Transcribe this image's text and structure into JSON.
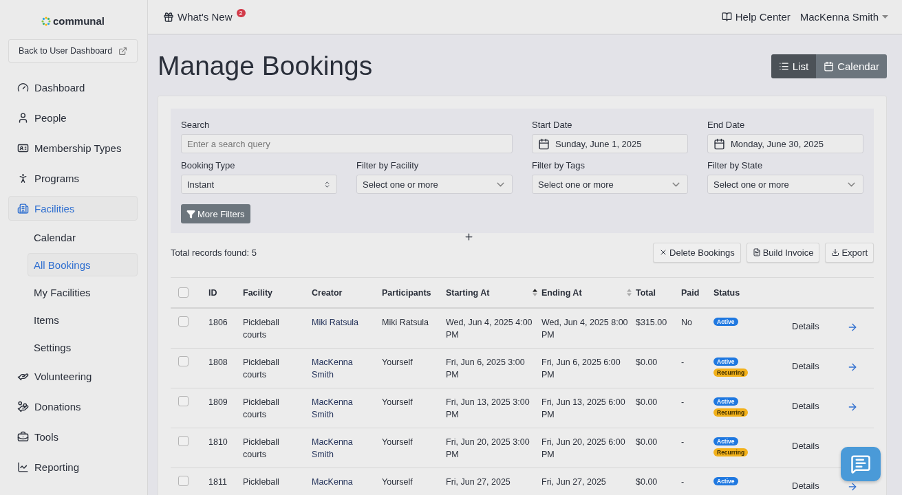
{
  "sidebar": {
    "logo": "communal",
    "back_button": "Back to User Dashboard",
    "items": [
      {
        "label": "Dashboard",
        "selected": false
      },
      {
        "label": "People",
        "selected": false
      },
      {
        "label": "Membership Types",
        "selected": false
      },
      {
        "label": "Programs",
        "selected": false
      },
      {
        "label": "Facilities",
        "selected": true,
        "children": [
          {
            "label": "Calendar",
            "selected": false
          },
          {
            "label": "All Bookings",
            "selected": true
          },
          {
            "label": "My Facilities",
            "selected": false
          },
          {
            "label": "Items",
            "selected": false
          },
          {
            "label": "Settings",
            "selected": false
          }
        ]
      },
      {
        "label": "Volunteering",
        "selected": false
      },
      {
        "label": "Donations",
        "selected": false
      },
      {
        "label": "Tools",
        "selected": false
      },
      {
        "label": "Reporting",
        "selected": false
      }
    ]
  },
  "topbar": {
    "whats_new": "What's New",
    "badge": "2",
    "help": "Help Center",
    "user": "MacKenna Smith"
  },
  "page": {
    "title": "Manage Bookings",
    "views": [
      {
        "label": "List",
        "selected": true
      },
      {
        "label": "Calendar",
        "selected": false
      }
    ]
  },
  "filters": [
    {
      "label": "Search",
      "kind": "text",
      "placeholder": "Enter a search query"
    },
    {
      "label": "Start Date",
      "kind": "date",
      "value": "Sunday, June 1, 2025"
    },
    {
      "label": "End Date",
      "kind": "date",
      "value": "Monday, June 30, 2025"
    },
    {
      "label": "Booking Type",
      "kind": "select",
      "value": "Instant"
    },
    {
      "label": "Filter by Facility",
      "kind": "multi",
      "placeholder": "Select one or more"
    },
    {
      "label": "Filter by Tags",
      "kind": "multi",
      "placeholder": "Select one or more"
    },
    {
      "label": "Filter by State",
      "kind": "multi",
      "placeholder": "Select one or more"
    }
  ],
  "more_filters": "More Filters",
  "total": "Total records found: 5",
  "actions": [
    "Delete Bookings",
    "Build Invoice",
    "Export"
  ],
  "table": {
    "select_all": {
      "checked": false
    },
    "columns": [
      {
        "label": "ID"
      },
      {
        "label": "Facility"
      },
      {
        "label": "Creator"
      },
      {
        "label": "Participants"
      },
      {
        "label": "Starting At",
        "sorted": true
      },
      {
        "label": "Ending At",
        "sorted": false
      },
      {
        "label": "Total"
      },
      {
        "label": "Paid"
      },
      {
        "label": "Status"
      }
    ],
    "rows": [
      {
        "checked": false,
        "id": "1806",
        "facility": "Pickleball courts",
        "creator": "Miki Ratsula",
        "participants": "Miki Ratsula",
        "start": "Wed, Jun 4, 2025 4:00 PM",
        "end": "Wed, Jun 4, 2025 8:00 PM",
        "total": "$315.00",
        "paid": "No",
        "statuses": [
          {
            "label": "Active",
            "kind": "active"
          }
        ],
        "details": "Details",
        "arrow": true
      },
      {
        "checked": false,
        "id": "1808",
        "facility": "Pickleball courts",
        "creator": "MacKenna Smith",
        "participants": "Yourself",
        "start": "Fri, Jun 6, 2025 3:00 PM",
        "end": "Fri, Jun 6, 2025 6:00 PM",
        "total": "$0.00",
        "paid": "-",
        "statuses": [
          {
            "label": "Active",
            "kind": "active"
          },
          {
            "label": "Recurring",
            "kind": "recurring"
          }
        ],
        "details": "Details",
        "arrow": true
      },
      {
        "checked": false,
        "id": "1809",
        "facility": "Pickleball courts",
        "creator": "MacKenna Smith",
        "participants": "Yourself",
        "start": "Fri, Jun 13, 2025 3:00 PM",
        "end": "Fri, Jun 13, 2025 6:00 PM",
        "total": "$0.00",
        "paid": "-",
        "statuses": [
          {
            "label": "Active",
            "kind": "active"
          },
          {
            "label": "Recurring",
            "kind": "recurring"
          }
        ],
        "details": "Details",
        "arrow": true
      },
      {
        "checked": false,
        "id": "1810",
        "facility": "Pickleball courts",
        "creator": "MacKenna Smith",
        "participants": "Yourself",
        "start": "Fri, Jun 20, 2025 3:00 PM",
        "end": "Fri, Jun 20, 2025 6:00 PM",
        "total": "$0.00",
        "paid": "-",
        "statuses": [
          {
            "label": "Active",
            "kind": "active"
          },
          {
            "label": "Recurring",
            "kind": "recurring"
          }
        ],
        "details": "Details",
        "arrow": false
      },
      {
        "checked": false,
        "id": "1811",
        "facility": "Pickleball",
        "creator": "MacKenna",
        "participants": "Yourself",
        "start": "Fri, Jun 27, 2025",
        "end": "Fri, Jun 27, 2025",
        "total": "$0.00",
        "paid": "-",
        "statuses": [
          {
            "label": "Active",
            "kind": "active"
          }
        ],
        "details": "Details",
        "arrow": true
      }
    ]
  }
}
